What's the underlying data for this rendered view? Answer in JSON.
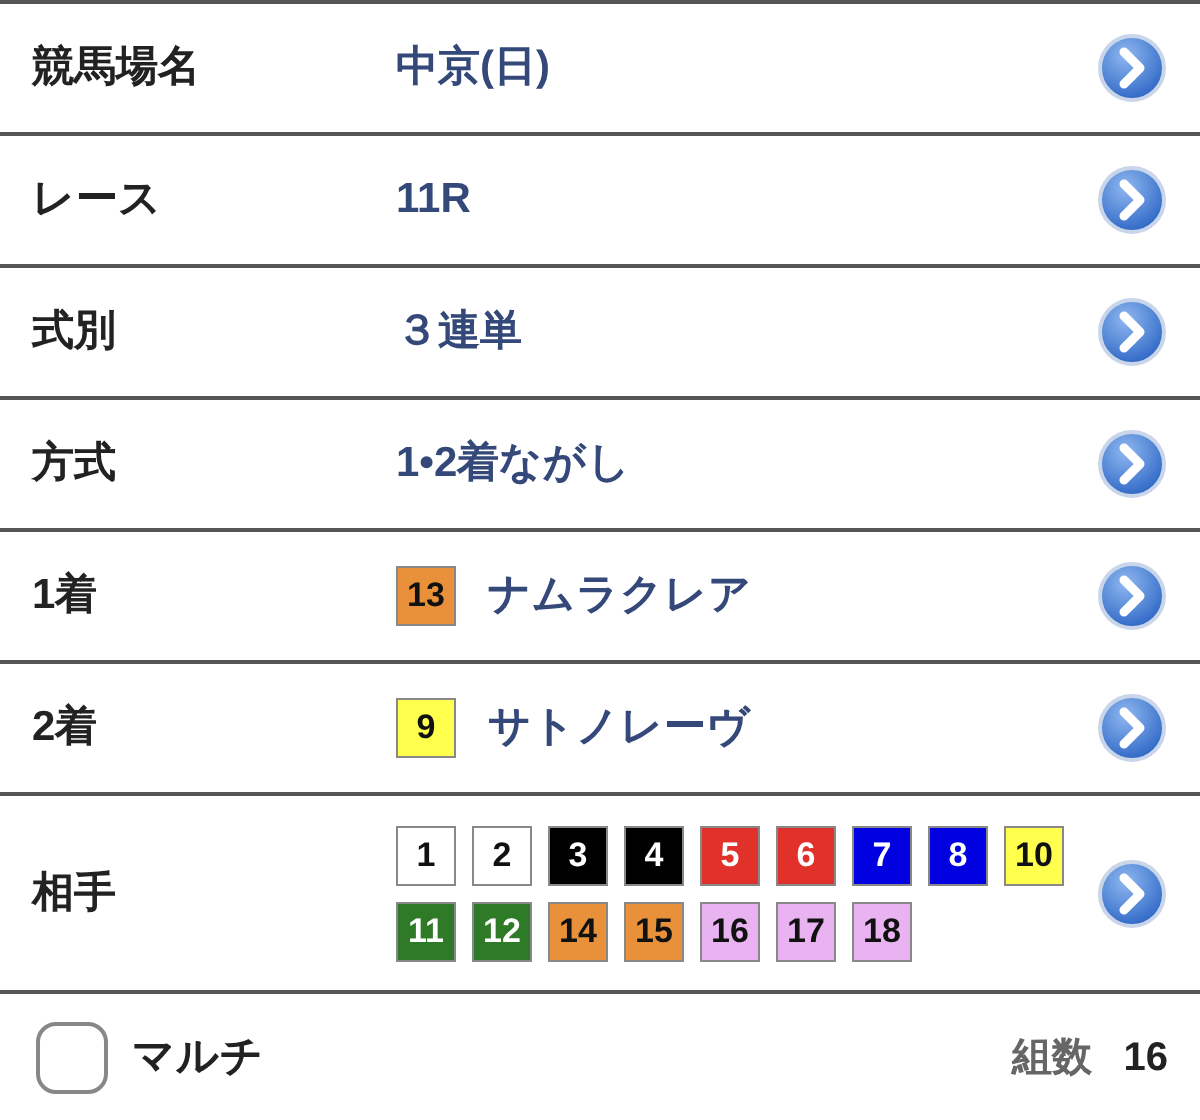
{
  "rows": [
    {
      "kind": "text",
      "label": "競馬場名",
      "value": "中京(日)"
    },
    {
      "kind": "text",
      "label": "レース",
      "value": "11R"
    },
    {
      "kind": "text",
      "label": "式別",
      "value": "３連単"
    },
    {
      "kind": "text",
      "label": "方式",
      "value": "1•2着ながし"
    },
    {
      "kind": "horse",
      "label": "1着",
      "number": {
        "text": "13",
        "color": "#e8913a"
      },
      "value": "ナムラクレア"
    },
    {
      "kind": "horse",
      "label": "2着",
      "number": {
        "text": "9",
        "color": "#ffff4d"
      },
      "value": "サトノレーヴ"
    },
    {
      "kind": "numbers",
      "label": "相手",
      "numbers": [
        {
          "text": "1",
          "color": "#ffffff"
        },
        {
          "text": "2",
          "color": "#ffffff"
        },
        {
          "text": "3",
          "color": "#000000"
        },
        {
          "text": "4",
          "color": "#000000"
        },
        {
          "text": "5",
          "color": "#e0312a"
        },
        {
          "text": "6",
          "color": "#e0312a"
        },
        {
          "text": "7",
          "color": "#0000e0"
        },
        {
          "text": "8",
          "color": "#0000e0"
        },
        {
          "text": "10",
          "color": "#ffff4d"
        },
        {
          "text": "11",
          "color": "#2e7a26"
        },
        {
          "text": "12",
          "color": "#2e7a26"
        },
        {
          "text": "14",
          "color": "#e8913a"
        },
        {
          "text": "15",
          "color": "#e8913a"
        },
        {
          "text": "16",
          "color": "#e8b3f0"
        },
        {
          "text": "17",
          "color": "#e8b3f0"
        },
        {
          "text": "18",
          "color": "#e8b3f0"
        }
      ]
    }
  ],
  "footer": {
    "multi": {
      "label": "マルチ",
      "checked": false
    },
    "count_label": "組数",
    "count": "16"
  }
}
